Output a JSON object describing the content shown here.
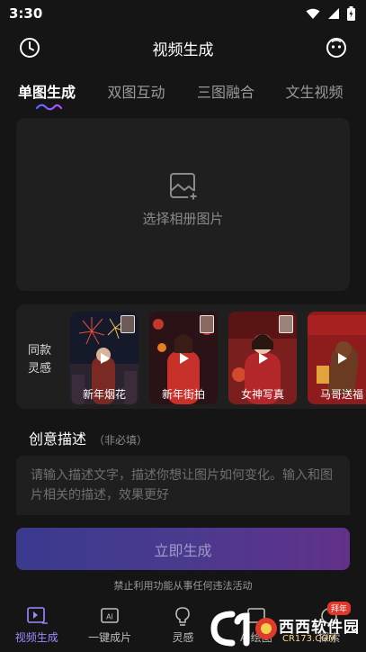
{
  "status_bar": {
    "time": "3:30"
  },
  "header": {
    "title": "视频生成"
  },
  "tabs": [
    {
      "label": "单图生成",
      "active": true
    },
    {
      "label": "双图互动",
      "active": false
    },
    {
      "label": "三图融合",
      "active": false
    },
    {
      "label": "文生视频",
      "active": false
    }
  ],
  "upload": {
    "label": "选择相册图片"
  },
  "inspiration": {
    "label": "同款灵感",
    "cards": [
      {
        "caption": "新年烟花"
      },
      {
        "caption": "新年街拍"
      },
      {
        "caption": "女神写真"
      },
      {
        "caption": "马哥送福"
      }
    ]
  },
  "description": {
    "title": "创意描述",
    "hint": "（非必填）",
    "placeholder": "请输入描述文字，描述你想让图片如何变化。输入和图片相关的描述，效果更好"
  },
  "generate_button": "立即生成",
  "disclaimer": "禁止利用功能从事任何违法活动",
  "bottom_nav": [
    {
      "label": "视频生成",
      "active": true
    },
    {
      "label": "一键成片",
      "active": false
    },
    {
      "label": "灵感",
      "active": false
    },
    {
      "label": "AI绘图",
      "active": false
    },
    {
      "label": "探索",
      "active": false
    }
  ],
  "watermark": {
    "text": "西西软件园",
    "sub": "CR173.COM",
    "badge": "拜年"
  },
  "colors": {
    "accent": "#9b8cff",
    "background": "#151515",
    "panel": "#1f1f1f"
  }
}
